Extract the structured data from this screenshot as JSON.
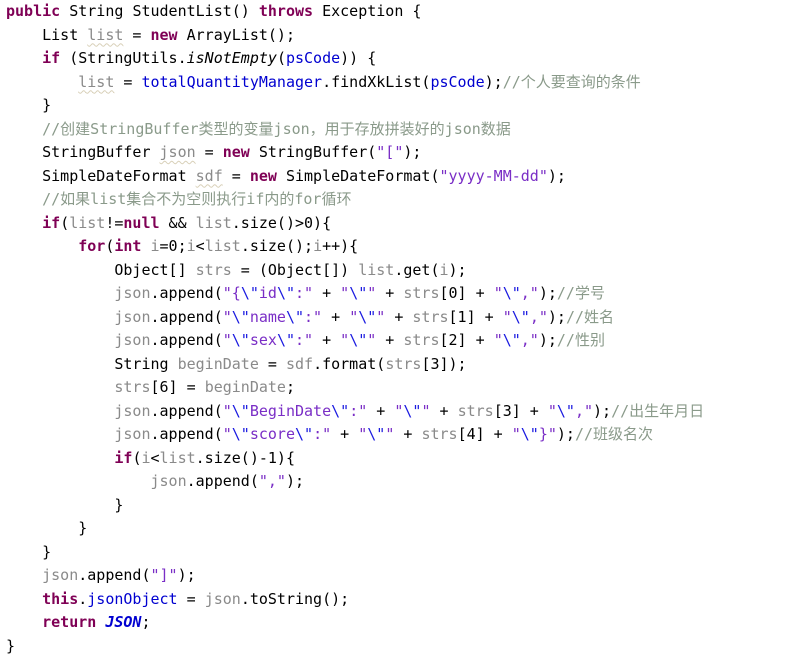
{
  "editor": {
    "language": "java",
    "background": "#ffffff",
    "method_name": "StudentList",
    "colors": {
      "keyword": "#7f0055",
      "string": "#7a2ec6",
      "escape": "#1a1ae0",
      "comment": "#8a9a8a",
      "field": "#0000d0",
      "local_variable": "#8a8a8a",
      "plain": "#000000",
      "constant": "#0000d0"
    }
  },
  "lines": [
    {
      "n": 1,
      "indent": 0,
      "tokens": [
        {
          "t": "public",
          "c": "keyword"
        },
        {
          "t": " ",
          "c": "plain"
        },
        {
          "t": "String",
          "c": "type"
        },
        {
          "t": " ",
          "c": "plain"
        },
        {
          "t": "StudentList",
          "c": "method"
        },
        {
          "t": "() ",
          "c": "plain"
        },
        {
          "t": "throws",
          "c": "keyword"
        },
        {
          "t": " Exception {",
          "c": "plain"
        }
      ]
    },
    {
      "n": 2,
      "indent": 1,
      "tokens": [
        {
          "t": "List ",
          "c": "type"
        },
        {
          "t": "list",
          "c": "local"
        },
        {
          "t": " = ",
          "c": "plain"
        },
        {
          "t": "new",
          "c": "keyword"
        },
        {
          "t": " ArrayList();",
          "c": "plain"
        }
      ]
    },
    {
      "n": 3,
      "indent": 1,
      "tokens": [
        {
          "t": "if",
          "c": "keyword"
        },
        {
          "t": " (StringUtils.",
          "c": "plain"
        },
        {
          "t": "isNotEmpty",
          "c": "static"
        },
        {
          "t": "(",
          "c": "plain"
        },
        {
          "t": "psCode",
          "c": "field"
        },
        {
          "t": ")) {",
          "c": "plain"
        }
      ]
    },
    {
      "n": 4,
      "indent": 2,
      "tokens": [
        {
          "t": "list",
          "c": "local"
        },
        {
          "t": " = ",
          "c": "plain"
        },
        {
          "t": "totalQuantityManager",
          "c": "field"
        },
        {
          "t": ".findXkList(",
          "c": "plain"
        },
        {
          "t": "psCode",
          "c": "field"
        },
        {
          "t": ");",
          "c": "plain"
        },
        {
          "t": "//个人要查询的条件",
          "c": "comment"
        }
      ]
    },
    {
      "n": 5,
      "indent": 1,
      "tokens": [
        {
          "t": "}",
          "c": "plain"
        }
      ]
    },
    {
      "n": 6,
      "indent": 1,
      "tokens": [
        {
          "t": "//创建StringBuffer类型的变量json，用于存放拼装好的json数据",
          "c": "comment"
        }
      ]
    },
    {
      "n": 7,
      "indent": 1,
      "tokens": [
        {
          "t": "StringBuffer ",
          "c": "type"
        },
        {
          "t": "json",
          "c": "local"
        },
        {
          "t": " = ",
          "c": "plain"
        },
        {
          "t": "new",
          "c": "keyword"
        },
        {
          "t": " StringBuffer(",
          "c": "plain"
        },
        {
          "t": "\"[\"",
          "c": "string"
        },
        {
          "t": ");",
          "c": "plain"
        }
      ]
    },
    {
      "n": 8,
      "indent": 1,
      "tokens": [
        {
          "t": "SimpleDateFormat ",
          "c": "type"
        },
        {
          "t": "sdf",
          "c": "local"
        },
        {
          "t": " = ",
          "c": "plain"
        },
        {
          "t": "new",
          "c": "keyword"
        },
        {
          "t": " SimpleDateFormat(",
          "c": "plain"
        },
        {
          "t": "\"yyyy-MM-dd\"",
          "c": "string"
        },
        {
          "t": ");",
          "c": "plain"
        }
      ]
    },
    {
      "n": 9,
      "indent": 1,
      "tokens": [
        {
          "t": "//如果list集合不为空则执行if内的for循环",
          "c": "comment"
        }
      ]
    },
    {
      "n": 10,
      "indent": 1,
      "tokens": [
        {
          "t": "if",
          "c": "keyword"
        },
        {
          "t": "(",
          "c": "plain"
        },
        {
          "t": "list",
          "c": "localnu"
        },
        {
          "t": "!=",
          "c": "plain"
        },
        {
          "t": "null",
          "c": "keyword"
        },
        {
          "t": " && ",
          "c": "plain"
        },
        {
          "t": "list",
          "c": "localnu"
        },
        {
          "t": ".size()>0){",
          "c": "plain"
        }
      ]
    },
    {
      "n": 11,
      "indent": 2,
      "tokens": [
        {
          "t": "for",
          "c": "keyword"
        },
        {
          "t": "(",
          "c": "plain"
        },
        {
          "t": "int",
          "c": "keyword"
        },
        {
          "t": " ",
          "c": "plain"
        },
        {
          "t": "i",
          "c": "localnu"
        },
        {
          "t": "=0;",
          "c": "plain"
        },
        {
          "t": "i",
          "c": "localnu"
        },
        {
          "t": "<",
          "c": "plain"
        },
        {
          "t": "list",
          "c": "localnu"
        },
        {
          "t": ".size();",
          "c": "plain"
        },
        {
          "t": "i",
          "c": "localnu"
        },
        {
          "t": "++){",
          "c": "plain"
        }
      ]
    },
    {
      "n": 12,
      "indent": 3,
      "tokens": [
        {
          "t": "Object[] ",
          "c": "type"
        },
        {
          "t": "strs",
          "c": "localnu"
        },
        {
          "t": " = (Object[]) ",
          "c": "plain"
        },
        {
          "t": "list",
          "c": "localnu"
        },
        {
          "t": ".get(",
          "c": "plain"
        },
        {
          "t": "i",
          "c": "localnu"
        },
        {
          "t": ");",
          "c": "plain"
        }
      ]
    },
    {
      "n": 13,
      "indent": 3,
      "tokens": [
        {
          "t": "json",
          "c": "localnu"
        },
        {
          "t": ".append(",
          "c": "plain"
        },
        {
          "t": "\"{",
          "c": "string"
        },
        {
          "t": "\\\"",
          "c": "escape"
        },
        {
          "t": "id",
          "c": "string"
        },
        {
          "t": "\\\"",
          "c": "escape"
        },
        {
          "t": ":\"",
          "c": "string"
        },
        {
          "t": " + ",
          "c": "plain"
        },
        {
          "t": "\"",
          "c": "string"
        },
        {
          "t": "\\\"",
          "c": "escape"
        },
        {
          "t": "\"",
          "c": "string"
        },
        {
          "t": " + ",
          "c": "plain"
        },
        {
          "t": "strs",
          "c": "localnu"
        },
        {
          "t": "[0] + ",
          "c": "plain"
        },
        {
          "t": "\"",
          "c": "string"
        },
        {
          "t": "\\\"",
          "c": "escape"
        },
        {
          "t": ",\"",
          "c": "string"
        },
        {
          "t": ");",
          "c": "plain"
        },
        {
          "t": "//学号",
          "c": "comment"
        }
      ]
    },
    {
      "n": 14,
      "indent": 3,
      "tokens": [
        {
          "t": "json",
          "c": "localnu"
        },
        {
          "t": ".append(",
          "c": "plain"
        },
        {
          "t": "\"",
          "c": "string"
        },
        {
          "t": "\\\"",
          "c": "escape"
        },
        {
          "t": "name",
          "c": "string"
        },
        {
          "t": "\\\"",
          "c": "escape"
        },
        {
          "t": ":\"",
          "c": "string"
        },
        {
          "t": " + ",
          "c": "plain"
        },
        {
          "t": "\"",
          "c": "string"
        },
        {
          "t": "\\\"",
          "c": "escape"
        },
        {
          "t": "\"",
          "c": "string"
        },
        {
          "t": " + ",
          "c": "plain"
        },
        {
          "t": "strs",
          "c": "localnu"
        },
        {
          "t": "[1] + ",
          "c": "plain"
        },
        {
          "t": "\"",
          "c": "string"
        },
        {
          "t": "\\\"",
          "c": "escape"
        },
        {
          "t": ",\"",
          "c": "string"
        },
        {
          "t": ");",
          "c": "plain"
        },
        {
          "t": "//姓名",
          "c": "comment"
        }
      ]
    },
    {
      "n": 15,
      "indent": 3,
      "tokens": [
        {
          "t": "json",
          "c": "localnu"
        },
        {
          "t": ".append(",
          "c": "plain"
        },
        {
          "t": "\"",
          "c": "string"
        },
        {
          "t": "\\\"",
          "c": "escape"
        },
        {
          "t": "sex",
          "c": "string"
        },
        {
          "t": "\\\"",
          "c": "escape"
        },
        {
          "t": ":\"",
          "c": "string"
        },
        {
          "t": " + ",
          "c": "plain"
        },
        {
          "t": "\"",
          "c": "string"
        },
        {
          "t": "\\\"",
          "c": "escape"
        },
        {
          "t": "\"",
          "c": "string"
        },
        {
          "t": " + ",
          "c": "plain"
        },
        {
          "t": "strs",
          "c": "localnu"
        },
        {
          "t": "[2] + ",
          "c": "plain"
        },
        {
          "t": "\"",
          "c": "string"
        },
        {
          "t": "\\\"",
          "c": "escape"
        },
        {
          "t": ",\"",
          "c": "string"
        },
        {
          "t": ");",
          "c": "plain"
        },
        {
          "t": "//性别",
          "c": "comment"
        }
      ]
    },
    {
      "n": 16,
      "indent": 3,
      "tokens": [
        {
          "t": "String ",
          "c": "type"
        },
        {
          "t": "beginDate",
          "c": "localnu"
        },
        {
          "t": " = ",
          "c": "plain"
        },
        {
          "t": "sdf",
          "c": "localnu"
        },
        {
          "t": ".format(",
          "c": "plain"
        },
        {
          "t": "strs",
          "c": "localnu"
        },
        {
          "t": "[3]);",
          "c": "plain"
        }
      ]
    },
    {
      "n": 17,
      "indent": 3,
      "tokens": [
        {
          "t": "strs",
          "c": "localnu"
        },
        {
          "t": "[6] = ",
          "c": "plain"
        },
        {
          "t": "beginDate",
          "c": "localnu"
        },
        {
          "t": ";",
          "c": "plain"
        }
      ]
    },
    {
      "n": 18,
      "indent": 3,
      "tokens": [
        {
          "t": "json",
          "c": "localnu"
        },
        {
          "t": ".append(",
          "c": "plain"
        },
        {
          "t": "\"",
          "c": "string"
        },
        {
          "t": "\\\"",
          "c": "escape"
        },
        {
          "t": "BeginDate",
          "c": "string"
        },
        {
          "t": "\\\"",
          "c": "escape"
        },
        {
          "t": ":\"",
          "c": "string"
        },
        {
          "t": " + ",
          "c": "plain"
        },
        {
          "t": "\"",
          "c": "string"
        },
        {
          "t": "\\\"",
          "c": "escape"
        },
        {
          "t": "\"",
          "c": "string"
        },
        {
          "t": " + ",
          "c": "plain"
        },
        {
          "t": "strs",
          "c": "localnu"
        },
        {
          "t": "[3] + ",
          "c": "plain"
        },
        {
          "t": "\"",
          "c": "string"
        },
        {
          "t": "\\\"",
          "c": "escape"
        },
        {
          "t": ",\"",
          "c": "string"
        },
        {
          "t": ");",
          "c": "plain"
        },
        {
          "t": "//出生年月日",
          "c": "comment"
        }
      ]
    },
    {
      "n": 19,
      "indent": 3,
      "tokens": [
        {
          "t": "json",
          "c": "localnu"
        },
        {
          "t": ".append(",
          "c": "plain"
        },
        {
          "t": "\"",
          "c": "string"
        },
        {
          "t": "\\\"",
          "c": "escape"
        },
        {
          "t": "score",
          "c": "string"
        },
        {
          "t": "\\\"",
          "c": "escape"
        },
        {
          "t": ":\"",
          "c": "string"
        },
        {
          "t": " + ",
          "c": "plain"
        },
        {
          "t": "\"",
          "c": "string"
        },
        {
          "t": "\\\"",
          "c": "escape"
        },
        {
          "t": "\"",
          "c": "string"
        },
        {
          "t": " + ",
          "c": "plain"
        },
        {
          "t": "strs",
          "c": "localnu"
        },
        {
          "t": "[4] + ",
          "c": "plain"
        },
        {
          "t": "\"",
          "c": "string"
        },
        {
          "t": "\\\"",
          "c": "escape"
        },
        {
          "t": "}\"",
          "c": "string"
        },
        {
          "t": ");",
          "c": "plain"
        },
        {
          "t": "//班级名次",
          "c": "comment"
        }
      ]
    },
    {
      "n": 20,
      "indent": 3,
      "tokens": [
        {
          "t": "if",
          "c": "keyword"
        },
        {
          "t": "(",
          "c": "plain"
        },
        {
          "t": "i",
          "c": "localnu"
        },
        {
          "t": "<",
          "c": "plain"
        },
        {
          "t": "list",
          "c": "localnu"
        },
        {
          "t": ".size()-1){",
          "c": "plain"
        }
      ]
    },
    {
      "n": 21,
      "indent": 4,
      "tokens": [
        {
          "t": "json",
          "c": "localnu"
        },
        {
          "t": ".append(",
          "c": "plain"
        },
        {
          "t": "\",\"",
          "c": "string"
        },
        {
          "t": ");",
          "c": "plain"
        }
      ]
    },
    {
      "n": 22,
      "indent": 3,
      "tokens": [
        {
          "t": "}",
          "c": "plain"
        }
      ]
    },
    {
      "n": 23,
      "indent": 2,
      "tokens": [
        {
          "t": "}",
          "c": "plain"
        }
      ]
    },
    {
      "n": 24,
      "indent": 1,
      "tokens": [
        {
          "t": "}",
          "c": "plain"
        }
      ]
    },
    {
      "n": 25,
      "indent": 1,
      "tokens": [
        {
          "t": "json",
          "c": "localnu"
        },
        {
          "t": ".append(",
          "c": "plain"
        },
        {
          "t": "\"]\"",
          "c": "string"
        },
        {
          "t": ");",
          "c": "plain"
        }
      ]
    },
    {
      "n": 26,
      "indent": 1,
      "tokens": [
        {
          "t": "this",
          "c": "keyword"
        },
        {
          "t": ".",
          "c": "plain"
        },
        {
          "t": "jsonObject",
          "c": "field"
        },
        {
          "t": " = ",
          "c": "plain"
        },
        {
          "t": "json",
          "c": "localnu"
        },
        {
          "t": ".toString();",
          "c": "plain"
        }
      ]
    },
    {
      "n": 27,
      "indent": 1,
      "tokens": [
        {
          "t": "return",
          "c": "keyword"
        },
        {
          "t": " ",
          "c": "plain"
        },
        {
          "t": "JSON",
          "c": "constant"
        },
        {
          "t": ";",
          "c": "plain"
        }
      ]
    },
    {
      "n": 28,
      "indent": 0,
      "tokens": [
        {
          "t": "}",
          "c": "plain"
        }
      ]
    }
  ]
}
